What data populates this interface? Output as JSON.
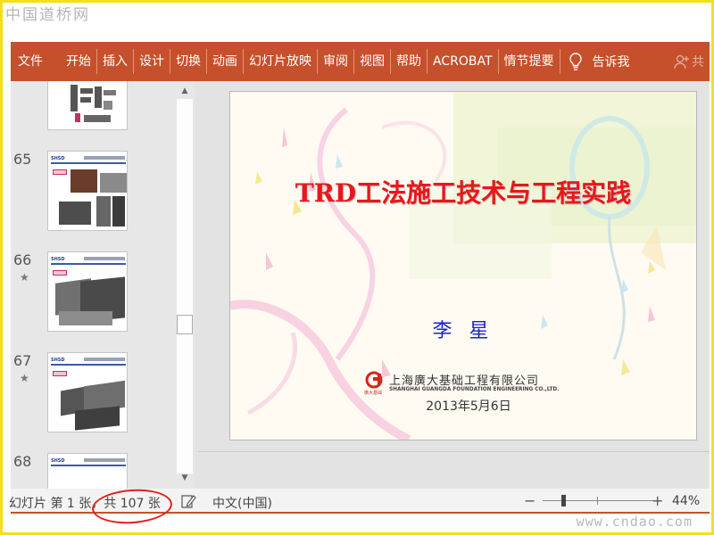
{
  "watermark": {
    "top": "中国道桥网",
    "bottom": "www.cndao.com"
  },
  "ribbon": {
    "tabs": [
      "文件",
      "开始",
      "插入",
      "设计",
      "切换",
      "动画",
      "幻灯片放映",
      "审阅",
      "视图",
      "帮助",
      "ACROBAT",
      "情节提要"
    ],
    "tell_me": "告诉我",
    "share_label": "共",
    "bulb_icon": "lightbulb-icon",
    "share_icon": "person-add-icon",
    "color": "#c6502b"
  },
  "thumbnails": {
    "slides": [
      {
        "number": "",
        "has_star": false
      },
      {
        "number": "65",
        "has_star": false
      },
      {
        "number": "66",
        "has_star": true
      },
      {
        "number": "67",
        "has_star": true
      },
      {
        "number": "68",
        "has_star": false
      }
    ],
    "star_glyph": "★",
    "scroll_up_glyph": "▲",
    "scroll_down_glyph": "▼"
  },
  "slide": {
    "title": "TRD工法施工技术与工程实践",
    "author": "李 星",
    "company_cn": "上海廣大基础工程有限公司",
    "company_en": "SHANGHAI GUANGDA FOUNDATION ENGINEERING CO.,LTD.",
    "company_sub": "廣大基础",
    "date": "2013年5月6日",
    "title_color": "#e8171b",
    "author_color": "#1a26c4"
  },
  "status_bar": {
    "slide_count": "幻灯片 第 1 张，共 107 张",
    "language": "中文(中国)",
    "zoom_minus": "−",
    "zoom_plus": "+",
    "zoom_percent": "44%",
    "zoom_level": 0.44,
    "notes_icon": "notes-icon"
  }
}
